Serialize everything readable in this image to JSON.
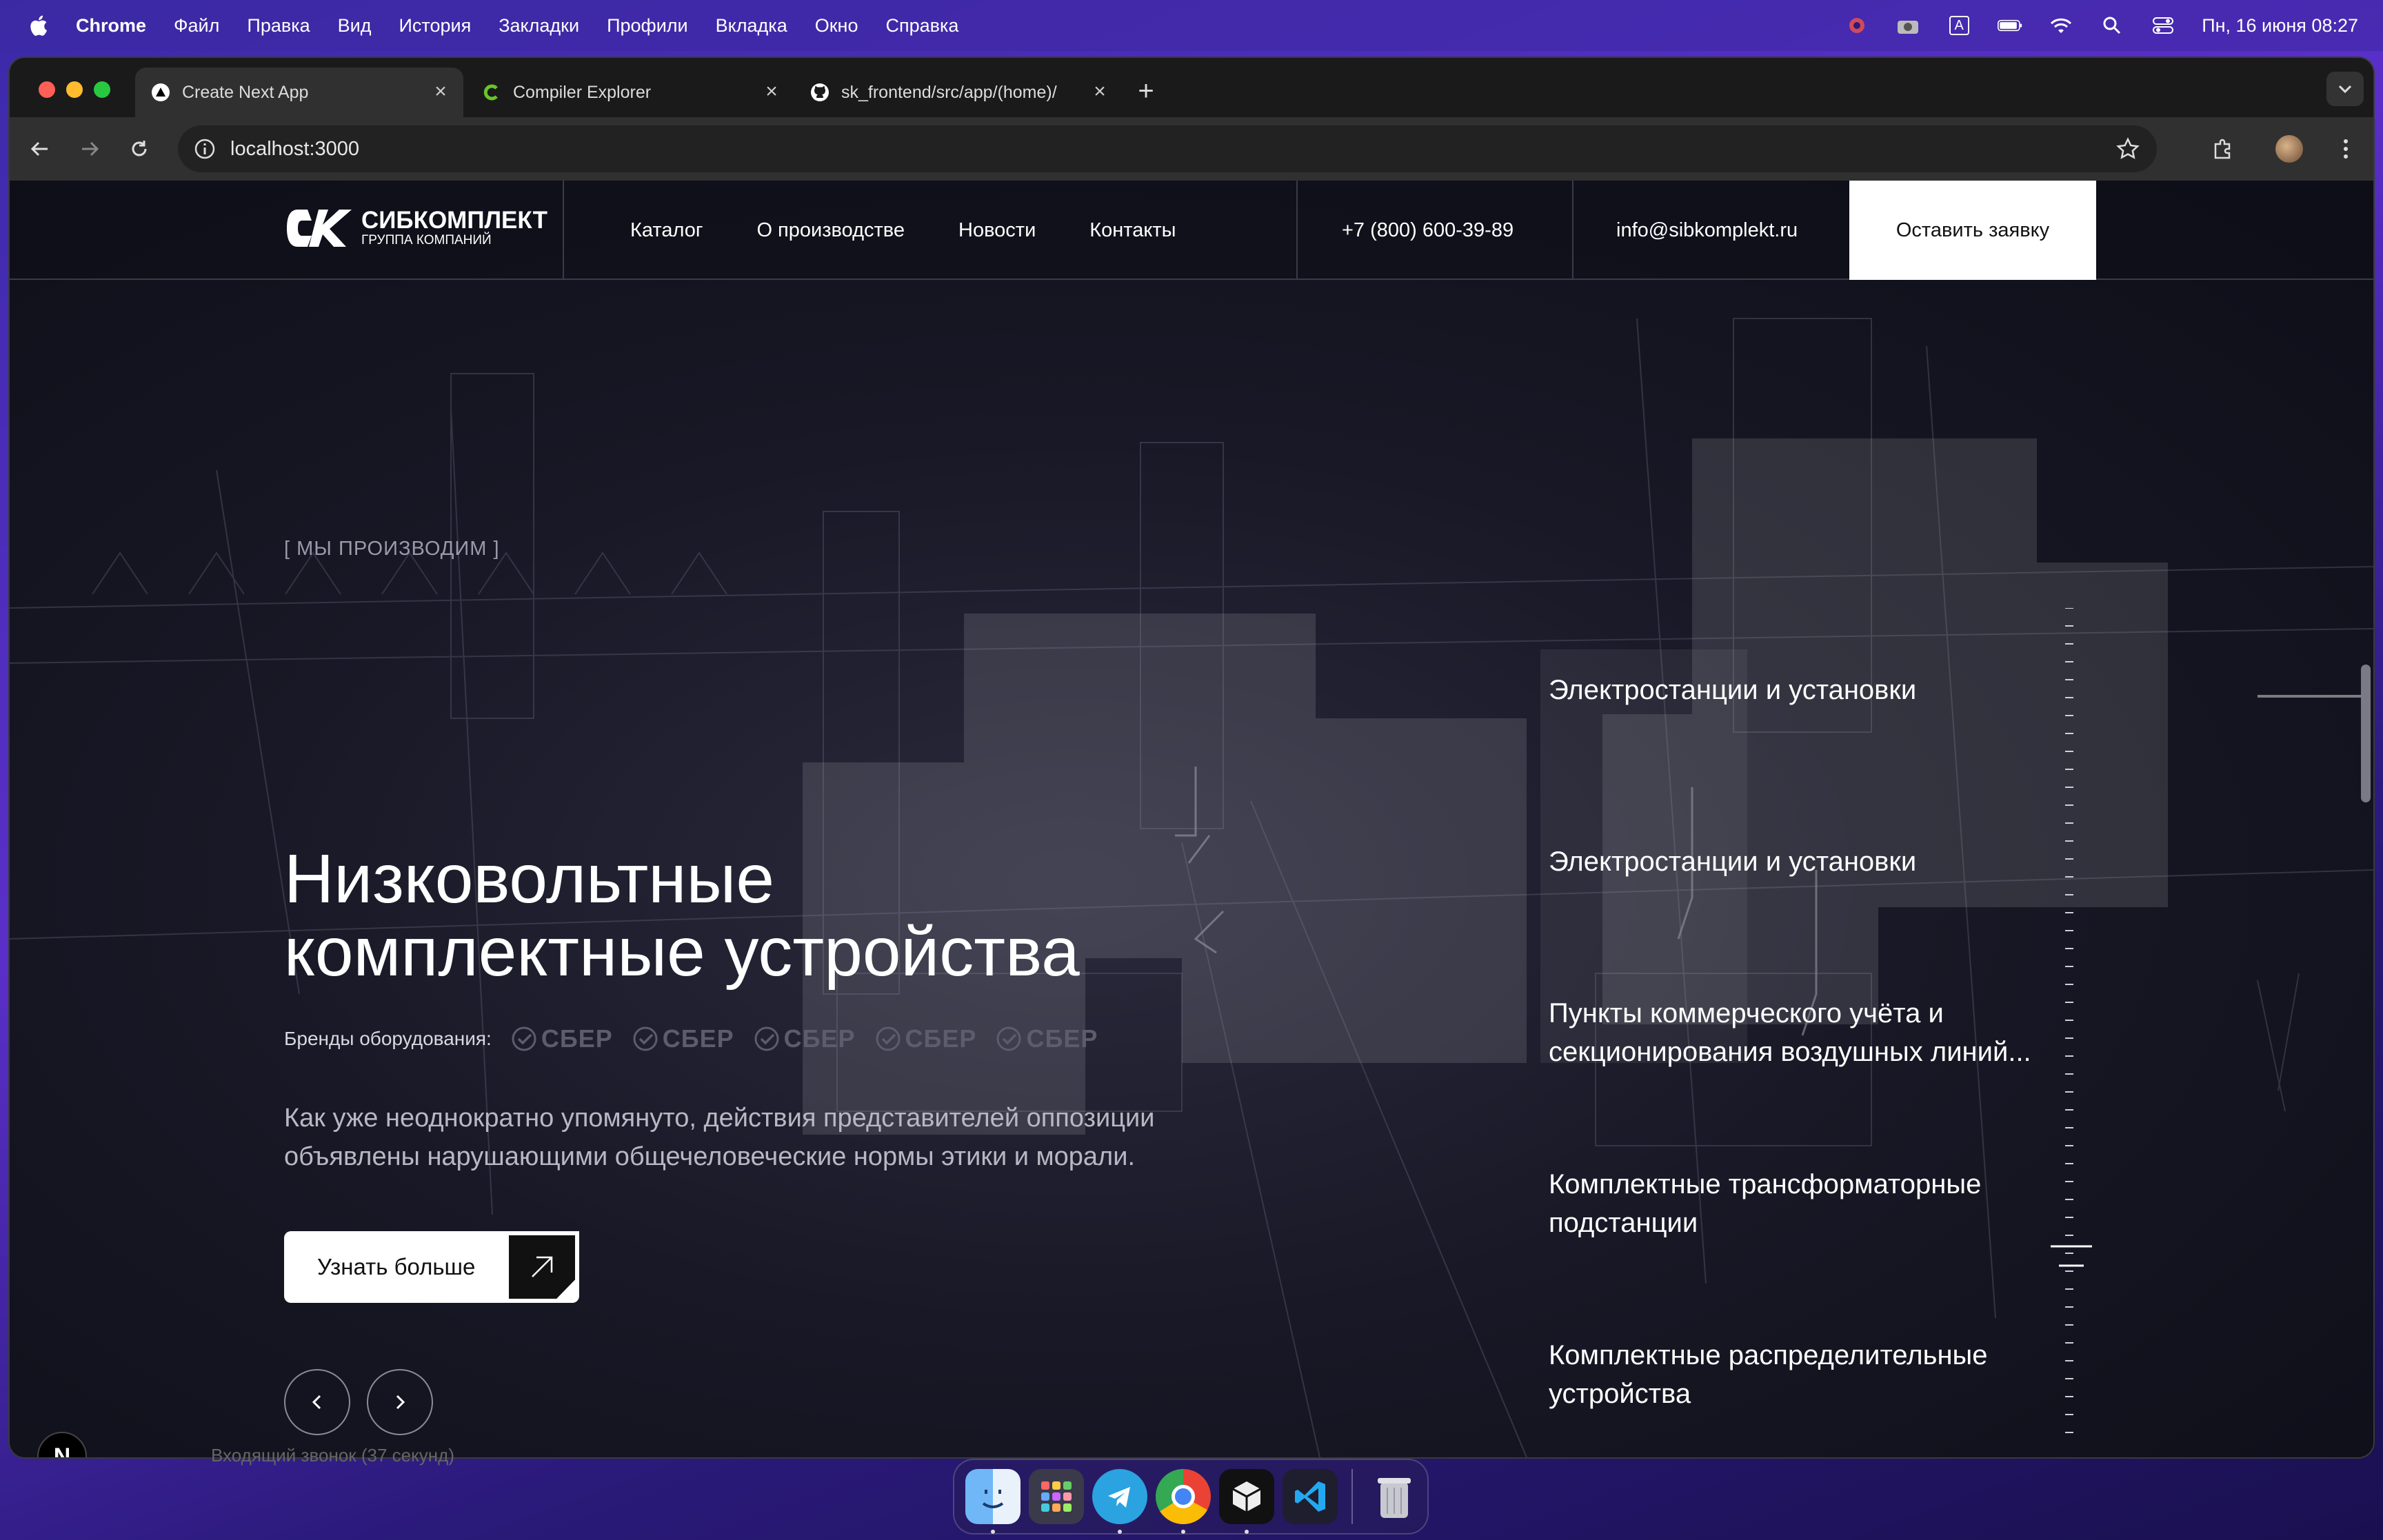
{
  "menubar": {
    "app_name": "Chrome",
    "items": [
      "Файл",
      "Правка",
      "Вид",
      "История",
      "Закладки",
      "Профили",
      "Вкладка",
      "Окно",
      "Справка"
    ],
    "clock": "Пн, 16 июня 08:27",
    "input_source": "A"
  },
  "browser": {
    "tabs": [
      {
        "title": "Create Next App",
        "icon": "nextjs-icon"
      },
      {
        "title": "Compiler Explorer",
        "icon": "compiler-explorer-icon"
      },
      {
        "title": "sk_frontend/src/app/(home)/",
        "icon": "github-icon"
      }
    ],
    "url": "localhost:3000"
  },
  "site": {
    "logo": {
      "name": "СИБКОМПЛЕКТ",
      "sub": "ГРУППА КОМПАНИЙ"
    },
    "nav": [
      "Каталог",
      "О производстве",
      "Новости",
      "Контакты"
    ],
    "phone": "+7 (800) 600-39-89",
    "email": "info@sibkomplekt.ru",
    "cta": "Оставить заявку",
    "eyebrow": "[ МЫ ПРОИЗВОДИМ ]",
    "title_line1": "Низковольтные",
    "title_line2": "комплектные устройства",
    "brands_label": "Бренды оборудования:",
    "brand_name": "СБЕР",
    "description_line1": "Как уже неоднократно упомянуто, действия представителей оппозиции",
    "description_line2": "объявлены нарушающими общечеловеческие нормы этики и морали.",
    "more_button": "Узнать больше",
    "categories": [
      {
        "line1": "Электростанции и установки",
        "line2": ""
      },
      {
        "line1": "Электростанции и установки",
        "line2": ""
      },
      {
        "line1": "Пункты коммерческого учёта и",
        "line2": "секционирования воздушных линий..."
      },
      {
        "line1": "Комплектные трансформаторные",
        "line2": "подстанции"
      },
      {
        "line1": "Комплектные распределительные",
        "line2": "устройства"
      }
    ],
    "next_badge": "N",
    "under_text": "Входящий звонок (37 секунд)"
  },
  "colors": {
    "page_bg": "#181826",
    "accent_white": "#ffffff",
    "muted_text": "#9a9aaa"
  }
}
